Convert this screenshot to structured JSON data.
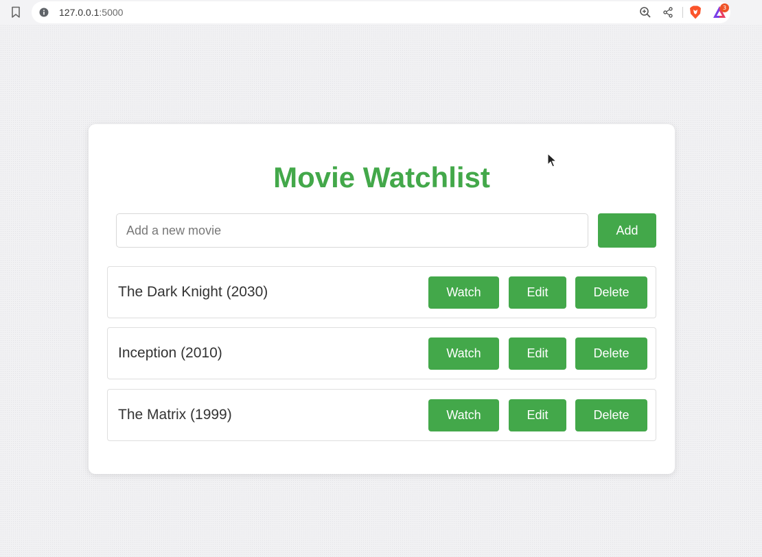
{
  "browser": {
    "url_host": "127.0.0.1",
    "url_port": ":5000",
    "rewards_badge_count": "3",
    "icons": [
      "bookmark-icon",
      "info-icon",
      "zoom-icon",
      "share-icon",
      "brave-shields-icon",
      "brave-rewards-icon"
    ]
  },
  "app": {
    "title": "Movie Watchlist",
    "input_placeholder": "Add a new movie",
    "input_value": "",
    "add_label": "Add",
    "accent_color": "#43a84a",
    "movies": [
      {
        "title": "The Dark Knight (2030)",
        "watch_label": "Watch",
        "edit_label": "Edit",
        "delete_label": "Delete"
      },
      {
        "title": "Inception (2010)",
        "watch_label": "Watch",
        "edit_label": "Edit",
        "delete_label": "Delete"
      },
      {
        "title": "The Matrix (1999)",
        "watch_label": "Watch",
        "edit_label": "Edit",
        "delete_label": "Delete"
      }
    ]
  }
}
